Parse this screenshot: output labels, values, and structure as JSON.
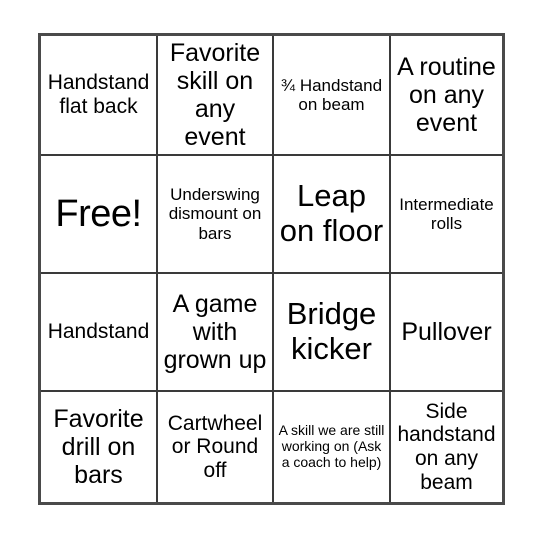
{
  "card": {
    "type": "bingo-card",
    "rows": 4,
    "columns": 4,
    "border_color": "#3a3a3a",
    "background_color": "#ffffff",
    "text_color": "#000000",
    "cells": [
      {
        "id": "r1c1",
        "text": "Handstand flat back",
        "size": "fs-md",
        "free_space": false
      },
      {
        "id": "r1c2",
        "text": "Favorite skill on any event",
        "size": "fs-lg",
        "free_space": false
      },
      {
        "id": "r1c3",
        "text": "¾ Handstand on beam",
        "size": "fs-sm",
        "free_space": false
      },
      {
        "id": "r1c4",
        "text": "A routine on any event",
        "size": "fs-lg",
        "free_space": false
      },
      {
        "id": "r2c1",
        "text": "Free!",
        "size": "fs-xxl",
        "free_space": true
      },
      {
        "id": "r2c2",
        "text": "Underswing dismount on bars",
        "size": "fs-sm",
        "free_space": false
      },
      {
        "id": "r2c3",
        "text": "Leap on floor",
        "size": "fs-xl",
        "free_space": false
      },
      {
        "id": "r2c4",
        "text": "Intermediate rolls",
        "size": "fs-sm",
        "free_space": false
      },
      {
        "id": "r3c1",
        "text": "Handstand",
        "size": "fs-md",
        "free_space": false
      },
      {
        "id": "r3c2",
        "text": "A game with grown up",
        "size": "fs-lg",
        "free_space": false
      },
      {
        "id": "r3c3",
        "text": "Bridge kicker",
        "size": "fs-xl",
        "free_space": false
      },
      {
        "id": "r3c4",
        "text": "Pullover",
        "size": "fs-lg",
        "free_space": false
      },
      {
        "id": "r4c1",
        "text": "Favorite drill on bars",
        "size": "fs-lg",
        "free_space": false
      },
      {
        "id": "r4c2",
        "text": "Cartwheel or Round off",
        "size": "fs-md",
        "free_space": false
      },
      {
        "id": "r4c3",
        "text": "A skill we are still working on (Ask a coach to help)",
        "size": "fs-xs",
        "free_space": false
      },
      {
        "id": "r4c4",
        "text": "Side handstand on any beam",
        "size": "fs-md",
        "free_space": false
      }
    ]
  }
}
